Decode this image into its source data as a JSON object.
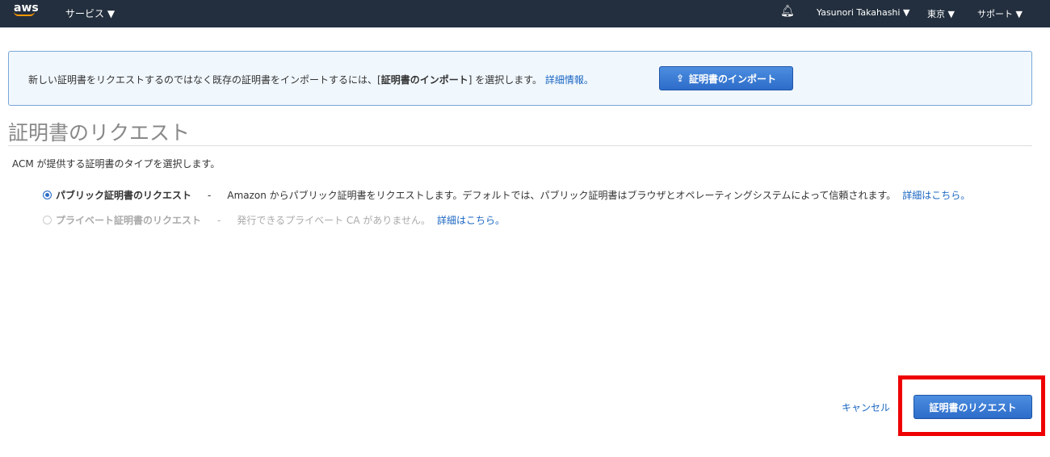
{
  "nav": {
    "logo": "aws",
    "services": "サービス ▼",
    "user": "Yasunori Takahashi ▼",
    "region": "東京 ▼",
    "support": "サポート ▼"
  },
  "info": {
    "text_before": "新しい証明書をリクエストするのではなく既存の証明書をインポートするには、[",
    "text_bold": "証明書のインポート",
    "text_after": "] を選択します。",
    "link": "詳細情報。",
    "import_button": "証明書のインポート"
  },
  "page": {
    "title": "証明書のリクエスト",
    "subtitle": "ACM が提供する証明書のタイプを選択します。"
  },
  "options": [
    {
      "label": "パブリック証明書のリクエスト",
      "sep": "-",
      "desc": "Amazon からパブリック証明書をリクエストします。デフォルトでは、パブリック証明書はブラウザとオペレーティングシステムによって信頼されます。",
      "link": "詳細はこちら。",
      "selected": true
    },
    {
      "label": "プライベート証明書のリクエスト",
      "sep": "-",
      "desc": "発行できるプライベート CA がありません。",
      "link": "詳細はこちら。",
      "selected": false
    }
  ],
  "footer": {
    "cancel": "キャンセル",
    "request": "証明書のリクエスト"
  },
  "colors": {
    "nav": "#232f3e",
    "accent": "#2d6cc9",
    "highlight": "#e00000"
  }
}
